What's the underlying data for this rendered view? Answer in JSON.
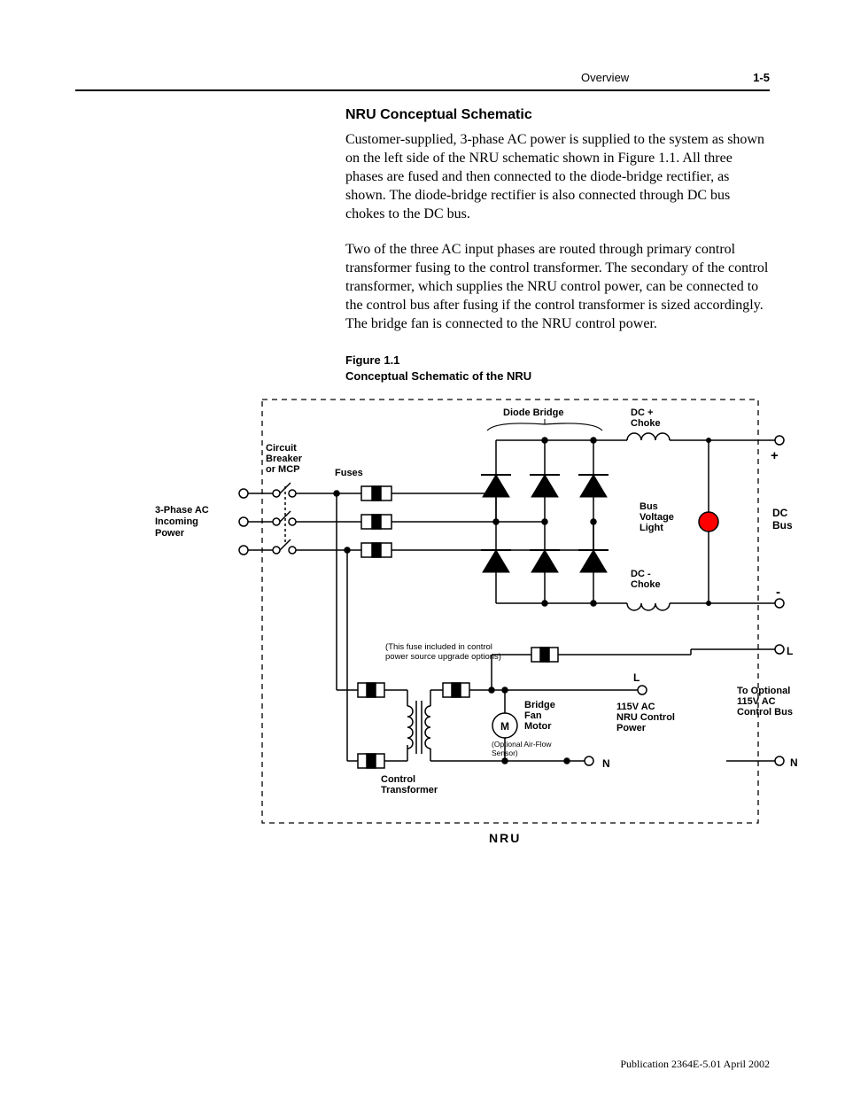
{
  "header": {
    "section": "Overview",
    "page": "1-5"
  },
  "title": "NRU Conceptual Schematic",
  "para1": "Customer-supplied, 3-phase AC power is supplied to the system as shown on the left side of the NRU schematic shown in Figure 1.1. All three phases are fused and then connected to the diode-bridge rectifier, as shown.  The diode-bridge rectifier is also connected through DC bus chokes to the DC bus.",
  "para2": "Two of the three AC input phases are routed through primary control transformer fusing to the control transformer.  The secondary of the control transformer, which supplies the NRU control power, can be connected to the control bus after fusing if the control transformer is sized accordingly.  The bridge fan is connected to the NRU control power.",
  "figure": {
    "num": "Figure 1.1",
    "title": "Conceptual Schematic of the NRU"
  },
  "labels": {
    "incoming": "3-Phase AC Incoming Power",
    "breaker": "Circuit Breaker or MCP",
    "fuses": "Fuses",
    "diode": "Diode Bridge",
    "dcplus": "DC + Choke",
    "dcminus": "DC - Choke",
    "bus": "Bus Voltage Light",
    "dcbus": "DC Bus",
    "plus": "+",
    "minus": "-",
    "L": "L",
    "N": "N",
    "transformer": "Control Transformer",
    "fan": "Bridge Fan Motor",
    "m": "M",
    "sensor": "(Optional Air-Flow Sensor)",
    "controlpower": "115V AC NRU Control Power",
    "optional": "To Optional 115V AC Control Bus",
    "note": "(This fuse included in control power source upgrade options)",
    "nru": "NRU"
  },
  "footer": "Publication 2364E-5.01 April 2002"
}
